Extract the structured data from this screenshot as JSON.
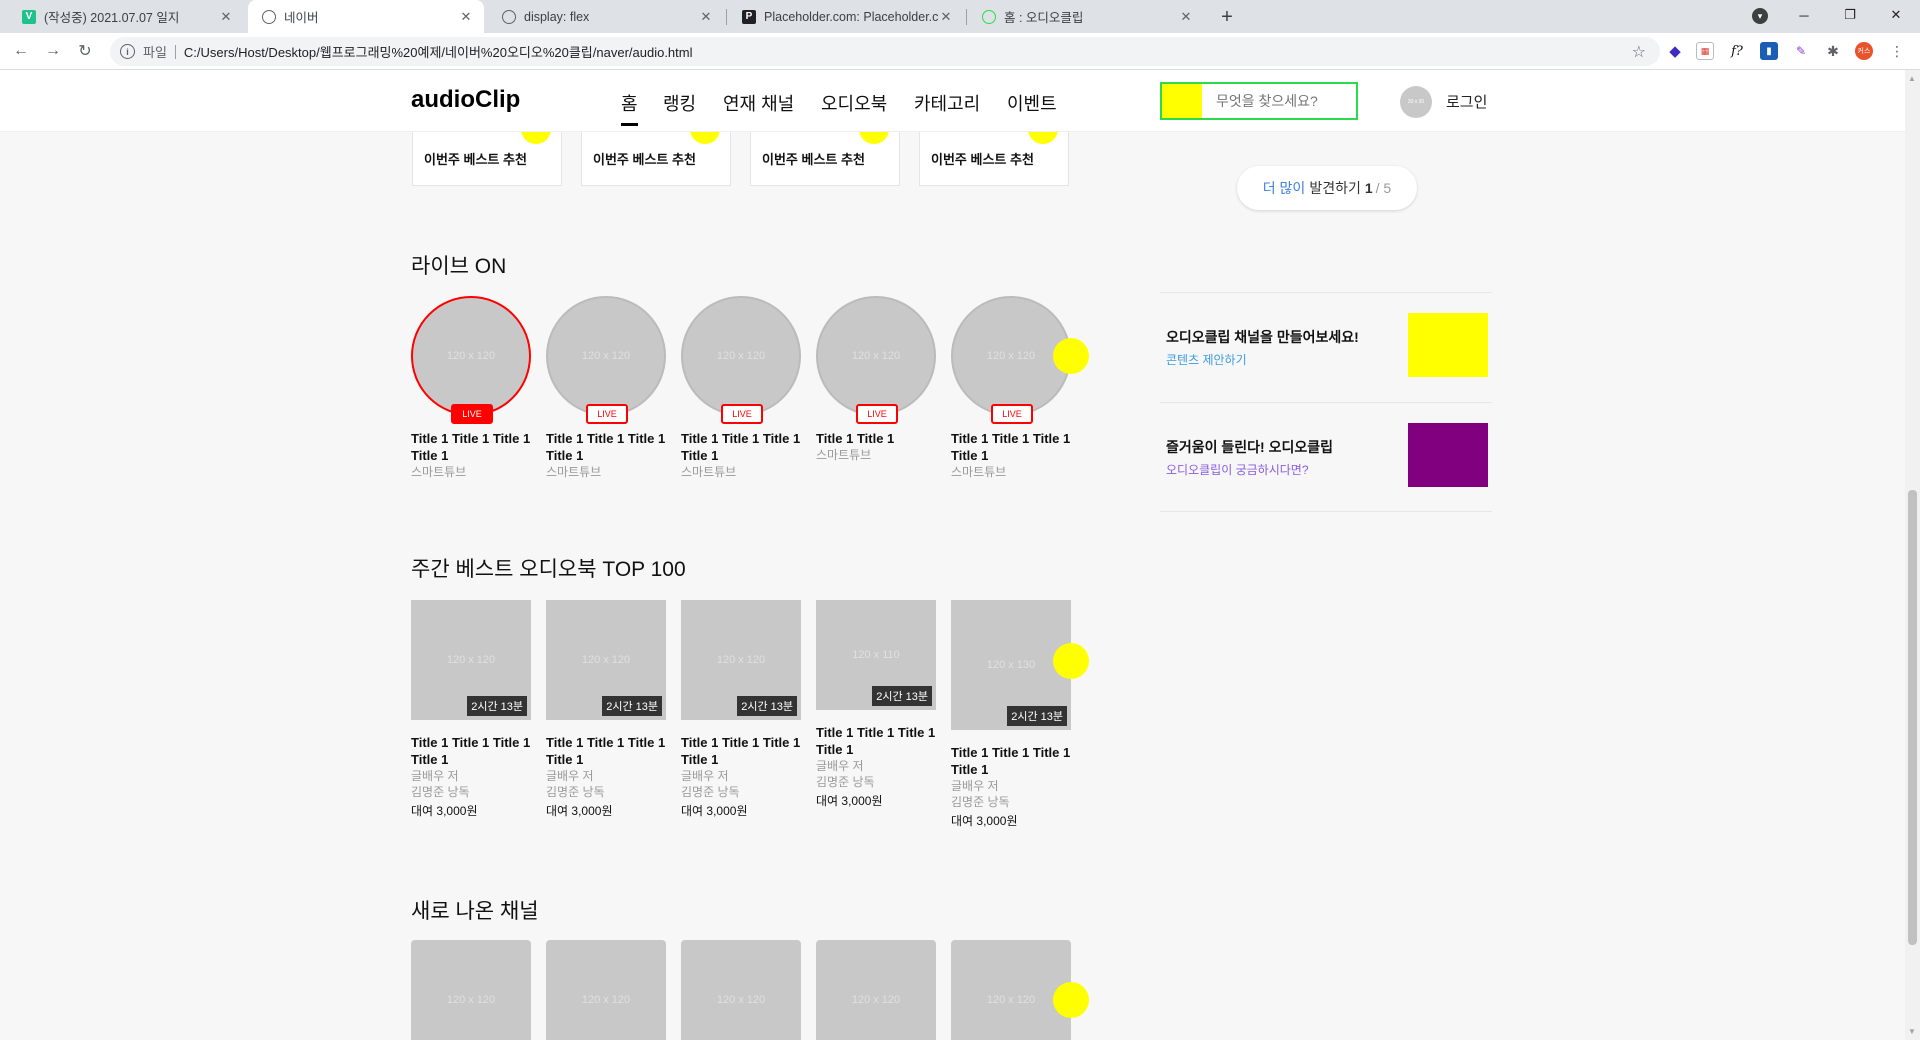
{
  "browser": {
    "tabs": [
      {
        "title": "(작성중) 2021.07.07 일지",
        "favicon": "V",
        "favicon_color": "#1ec28b"
      },
      {
        "title": "네이버",
        "favicon": "globe",
        "active": true
      },
      {
        "title": "display: flex",
        "favicon": "globe"
      },
      {
        "title": "Placeholder.com: Placeholder.co",
        "favicon": "P"
      },
      {
        "title": "홈 : 오디오클립",
        "favicon": "audioclip"
      }
    ],
    "url_scheme": "파일",
    "url": "C:/Users/Host/Desktop/웹프로그래밍%20예제/네이버%20오디오%20클립/naver/audio.html",
    "profile_label": "커스"
  },
  "header": {
    "logo": "audioClip",
    "nav": [
      "홈",
      "랭킹",
      "연재 채널",
      "오디오북",
      "카테고리",
      "이벤트"
    ],
    "search_placeholder": "무엇을 찾으세요?",
    "avatar_text": "30 x 30",
    "login": "로그인"
  },
  "best_cards": [
    {
      "label": "이번주 베스트 추천"
    },
    {
      "label": "이번주 베스트 추천"
    },
    {
      "label": "이번주 베스트 추천"
    },
    {
      "label": "이번주 베스트 추천"
    }
  ],
  "live": {
    "title": "라이브 ON",
    "items": [
      {
        "thumb": "120 x 120",
        "badge": "LIVE",
        "on": true,
        "title": "Title 1 Title 1 Title 1 Title 1",
        "channel": "스마트튜브"
      },
      {
        "thumb": "120 x 120",
        "badge": "LIVE",
        "on": false,
        "title": "Title 1 Title 1 Title 1 Title 1",
        "channel": "스마트튜브"
      },
      {
        "thumb": "120 x 120",
        "badge": "LIVE",
        "on": false,
        "title": "Title 1 Title 1 Title 1 Title 1",
        "channel": "스마트튜브"
      },
      {
        "thumb": "120 x 120",
        "badge": "LIVE",
        "on": false,
        "title": "Title 1 Title 1",
        "channel": "스마트튜브"
      },
      {
        "thumb": "120 x 120",
        "badge": "LIVE",
        "on": false,
        "title": "Title 1 Title 1 Title 1 Title 1",
        "channel": "스마트튜브"
      }
    ]
  },
  "audiobooks": {
    "title": "주간 베스트 오디오북 TOP 100",
    "items": [
      {
        "thumb": "120 x 120",
        "duration": "2시간 13분",
        "title": "Title 1 Title 1 Title 1 Title 1",
        "author": "글배우 저",
        "narrator": "김명준 낭독",
        "price": "대여 3,000원"
      },
      {
        "thumb": "120 x 120",
        "duration": "2시간 13분",
        "title": "Title 1 Title 1 Title 1 Title 1",
        "author": "글배우 저",
        "narrator": "김명준 낭독",
        "price": "대여 3,000원"
      },
      {
        "thumb": "120 x 120",
        "duration": "2시간 13분",
        "title": "Title 1 Title 1 Title 1 Title 1",
        "author": "글배우 저",
        "narrator": "김명준 낭독",
        "price": "대여 3,000원"
      },
      {
        "thumb": "120 x 110",
        "duration": "2시간 13분",
        "title": "Title 1 Title 1 Title 1 Title 1",
        "author": "글배우 저",
        "narrator": "김명준 낭독",
        "price": "대여 3,000원"
      },
      {
        "thumb": "120 x 130",
        "duration": "2시간 13분",
        "title": "Title 1 Title 1 Title 1 Title 1",
        "author": "글배우 저",
        "narrator": "김명준 낭독",
        "price": "대여 3,000원"
      }
    ]
  },
  "new_channels": {
    "title": "새로 나온 채널",
    "items": [
      "120 x 120",
      "120 x 120",
      "120 x 120",
      "120 x 120",
      "120 x 120"
    ]
  },
  "sidebar": {
    "more": {
      "accent": "더 많이",
      "text": "발견하기",
      "current": "1",
      "total": "/ 5"
    },
    "promos": [
      {
        "title": "오디오클립 채널을 만들어보세요!",
        "link": "콘텐츠 제안하기",
        "link_color": "#3d9be0",
        "image_color": "#ffff00"
      },
      {
        "title": "즐거움이 들린다! 오디오클립",
        "link": "오디오클립이 궁금하시다면?",
        "link_color": "#8a5ce0",
        "image_color": "#800080"
      }
    ]
  },
  "colors": {
    "accent_yellow": "#ffff00",
    "live_red": "#ff0000",
    "search_border": "#2bdb4b"
  }
}
